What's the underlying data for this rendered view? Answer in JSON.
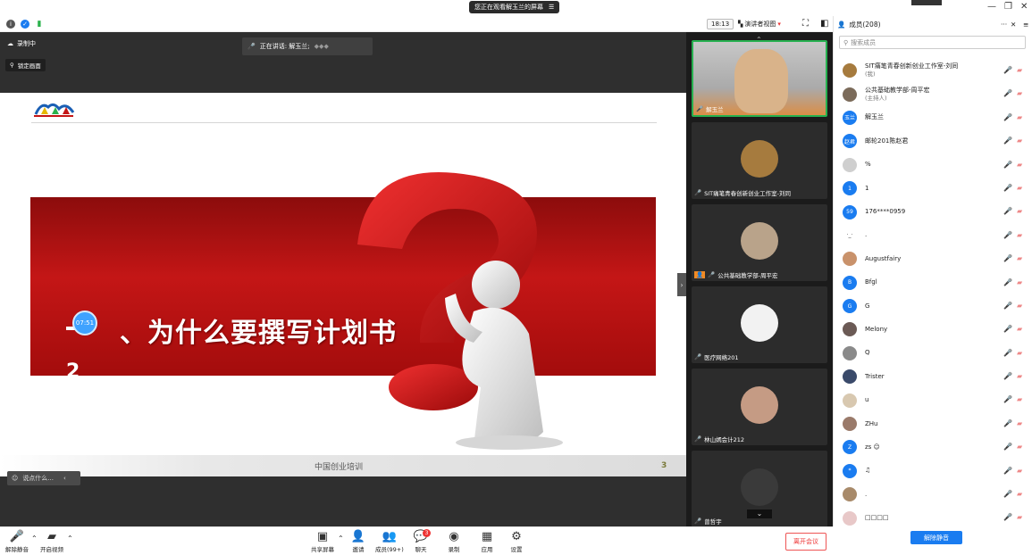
{
  "banner": {
    "text": "您正在观看解玉兰的屏幕",
    "icon": "menu-icon"
  },
  "window": {
    "min": "—",
    "restore": "❐",
    "close": "✕"
  },
  "header": {
    "timer": "18:13",
    "view_mode": "演讲者视图",
    "members_label": "成员(208)"
  },
  "stage": {
    "recording": "录制中",
    "pin": "锁定画面",
    "speaking_label": "正在讲话: 解玉兰;",
    "chat_placeholder": "说点什么...",
    "timer_bubble": "07:51"
  },
  "slide": {
    "heading": "为什么要撰写计划书",
    "heading_prefix": "、",
    "number": "2",
    "footer": "中国创业培训",
    "page": "3"
  },
  "thumbnails": [
    {
      "name": "解玉兰",
      "color": "#d9b38a"
    },
    {
      "name": "SIT痛笔青春创新创业工作室-刘同",
      "color": "#a67b3e"
    },
    {
      "name": "公共基础教学部-周平宏",
      "color": "#b9a38a"
    },
    {
      "name": "医疗网络201",
      "color": "#f2f2f2"
    },
    {
      "name": "林山嫣会计212",
      "color": "#c59b84"
    },
    {
      "name": "曾哲宇",
      "color": "#3a3a3a"
    }
  ],
  "panel": {
    "search_placeholder": "搜索成员",
    "unmute_all": "解除静音",
    "members": [
      {
        "name": "SIT痛笔青春创新创业工作室-刘同",
        "sub": "(我)",
        "avatar": "",
        "color": "#a67b3e"
      },
      {
        "name": "公共基础教学部-周平宏",
        "sub": "(主持人)",
        "avatar": "",
        "color": "#7b6b5a"
      },
      {
        "name": "解玉兰",
        "sub": "",
        "avatar": "玉兰",
        "color": "#1a7cf0"
      },
      {
        "name": "邮轮201陈赵君",
        "sub": "",
        "avatar": "赵君",
        "color": "#1a7cf0"
      },
      {
        "name": "%",
        "sub": "",
        "avatar": "",
        "color": "#cfcfcf"
      },
      {
        "name": "1",
        "sub": "",
        "avatar": "1",
        "color": "#1a7cf0"
      },
      {
        "name": "176****0959",
        "sub": "",
        "avatar": "59",
        "color": "#1a7cf0"
      },
      {
        "name": ".",
        "sub": "",
        "avatar": "·_·",
        "color": "#ffffff"
      },
      {
        "name": "Augustfairy",
        "sub": "",
        "avatar": "",
        "color": "#c9926b"
      },
      {
        "name": "Bfgl",
        "sub": "",
        "avatar": "B",
        "color": "#1a7cf0"
      },
      {
        "name": "G",
        "sub": "",
        "avatar": "G",
        "color": "#1a7cf0"
      },
      {
        "name": "Melony",
        "sub": "",
        "avatar": "",
        "color": "#6b5a55"
      },
      {
        "name": "Q",
        "sub": "",
        "avatar": "",
        "color": "#8a8a8a"
      },
      {
        "name": "Trister",
        "sub": "",
        "avatar": "",
        "color": "#3a4a6a"
      },
      {
        "name": "u",
        "sub": "",
        "avatar": "",
        "color": "#d8c8b0"
      },
      {
        "name": "ZHu",
        "sub": "",
        "avatar": "",
        "color": "#9a7a6a"
      },
      {
        "name": "zs ☺",
        "sub": "",
        "avatar": "Z",
        "color": "#1a7cf0"
      },
      {
        "name": "♫",
        "sub": "",
        "avatar": "*",
        "color": "#1a7cf0"
      },
      {
        "name": ".",
        "sub": "",
        "avatar": "",
        "color": "#a88a6a"
      },
      {
        "name": "□□□□",
        "sub": "",
        "avatar": "",
        "color": "#e8c8c8"
      }
    ]
  },
  "toolbar": {
    "mute": "解除静音",
    "video": "开启视频",
    "share": "共享屏幕",
    "invite": "邀请",
    "members": "成员(99+)",
    "chat": "聊天",
    "chat_badge": "3",
    "record": "录制",
    "apps": "应用",
    "settings": "设置",
    "leave": "离开会议"
  }
}
